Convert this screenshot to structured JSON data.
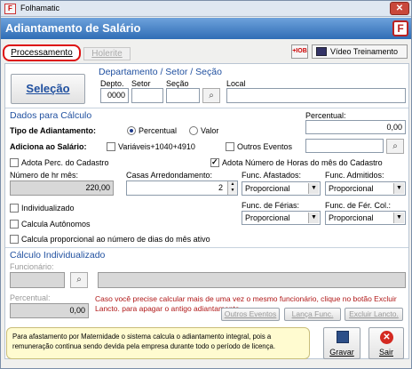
{
  "window": {
    "title": "Folhamatic",
    "close": "✕"
  },
  "header": {
    "title": "Adiantamento de Salário"
  },
  "tabs": [
    {
      "label": "Processamento",
      "active": true
    },
    {
      "label": "Holerite",
      "active": false
    }
  ],
  "toolbar": {
    "io_label": "+IOB",
    "video_label": "Vídeo Treinamento"
  },
  "selection": {
    "button": "Seleção",
    "group_title": "Departamento / Setor / Seção",
    "depto_label": "Depto.",
    "depto_value": "0000",
    "setor_label": "Setor",
    "secao_label": "Seção",
    "local_label": "Local"
  },
  "calc": {
    "title": "Dados para Cálculo",
    "tipo_label": "Tipo de Adiantamento:",
    "percentual_option": "Percentual",
    "valor_option": "Valor",
    "percentual_label": "Percentual:",
    "percentual_value": "0,00",
    "adiciona_label": "Adiciona ao Salário:",
    "variaveis_label": "Variáveis+1040+4910",
    "outros_eventos_label": "Outros Eventos",
    "adota_perc_label": "Adota Perc. do Cadastro",
    "adota_horas_label": "Adota Número de Horas do mês do Cadastro",
    "horas_label": "Número de hr mês:",
    "horas_value": "220,00",
    "casas_label": "Casas Arredondamento:",
    "casas_value": "2",
    "func_afast_label": "Func. Afastados:",
    "func_afast_value": "Proporcional",
    "func_adm_label": "Func. Admitidos:",
    "func_adm_value": "Proporcional",
    "individualizado_label": "Individualizado",
    "calcula_autonomos_label": "Calcula Autônomos",
    "func_ferias_label": "Func. de Férias:",
    "func_ferias_value": "Proporcional",
    "func_ferias_col_label": "Func. de Fér. Col.:",
    "func_ferias_col_value": "Proporcional",
    "calcula_prop_label": "Calcula proporcional ao número de dias do mês ativo"
  },
  "individual": {
    "title": "Cálculo Individualizado",
    "funcionario_label": "Funcionário:",
    "percentual_label": "Percentual:",
    "percentual_value": "0,00",
    "warning": "Caso você precise calcular mais de uma vez o mesmo funcionário, clique no botão Excluir Lancto. para apagar o antigo adiantamento.",
    "outros_eventos_btn": "Outros Eventos",
    "lanca_func_btn": "Lança Func.",
    "excluir_btn": "Excluir Lancto."
  },
  "footer": {
    "note": "Para afastamento por Maternidade o sistema calcula o adiantamento integral, pois a remuneração continua sendo devida pela empresa durante todo o período de licença.",
    "gravar": "Gravar",
    "sair": "Sair"
  },
  "colors": {
    "header": "#2f6db5",
    "section": "#1f4f9f",
    "warning": "#b01818"
  }
}
